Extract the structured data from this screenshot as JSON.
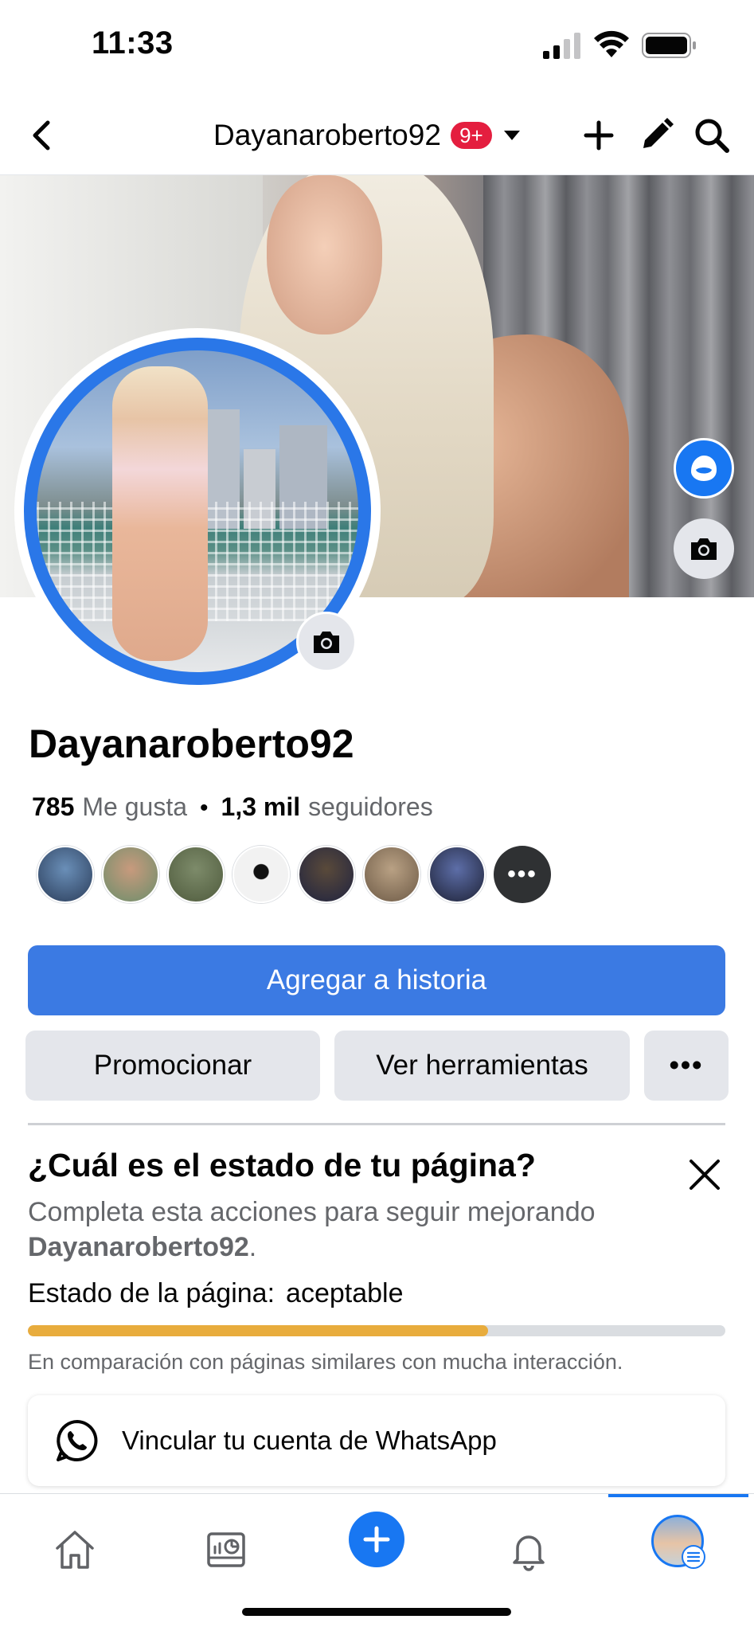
{
  "status_bar": {
    "time": "11:33"
  },
  "nav": {
    "page_name": "Dayanaroberto92",
    "notification_badge": "9+",
    "icons": [
      "back-arrow-icon",
      "caret-down-icon",
      "plus-icon",
      "pencil-icon",
      "search-icon"
    ]
  },
  "profile": {
    "name": "Dayanaroberto92",
    "likes_count": "785",
    "likes_label": "Me gusta",
    "separator": "•",
    "followers_count": "1,3 mil",
    "followers_label": "seguidores",
    "friend_avatars_count": 7,
    "more_label": "•••"
  },
  "actions": {
    "add_story": "Agregar a historia",
    "promote": "Promocionar",
    "tools": "Ver herramientas",
    "more": "•••"
  },
  "health_card": {
    "title": "¿Cuál es el estado de tu página?",
    "description_prefix": "Completa esta acciones para seguir mejorando",
    "description_page": "Dayanaroberto92",
    "description_suffix": ".",
    "status_label": "Estado de la página:",
    "status_value": "aceptable",
    "progress_fraction": 0.66,
    "progress_color": "#e8ac3d",
    "comparison": "En comparación con páginas similares con mucha interacción."
  },
  "whatsapp_card": {
    "label": "Vincular tu cuenta de WhatsApp"
  },
  "tabbar": {
    "tabs": [
      "home-icon",
      "dashboard-icon",
      "create-icon",
      "notifications-icon",
      "profile-avatar"
    ],
    "active": "profile-avatar"
  },
  "colors": {
    "accent": "#1877f2",
    "button_primary": "#3b7ae3",
    "badge": "#e41e3f"
  }
}
